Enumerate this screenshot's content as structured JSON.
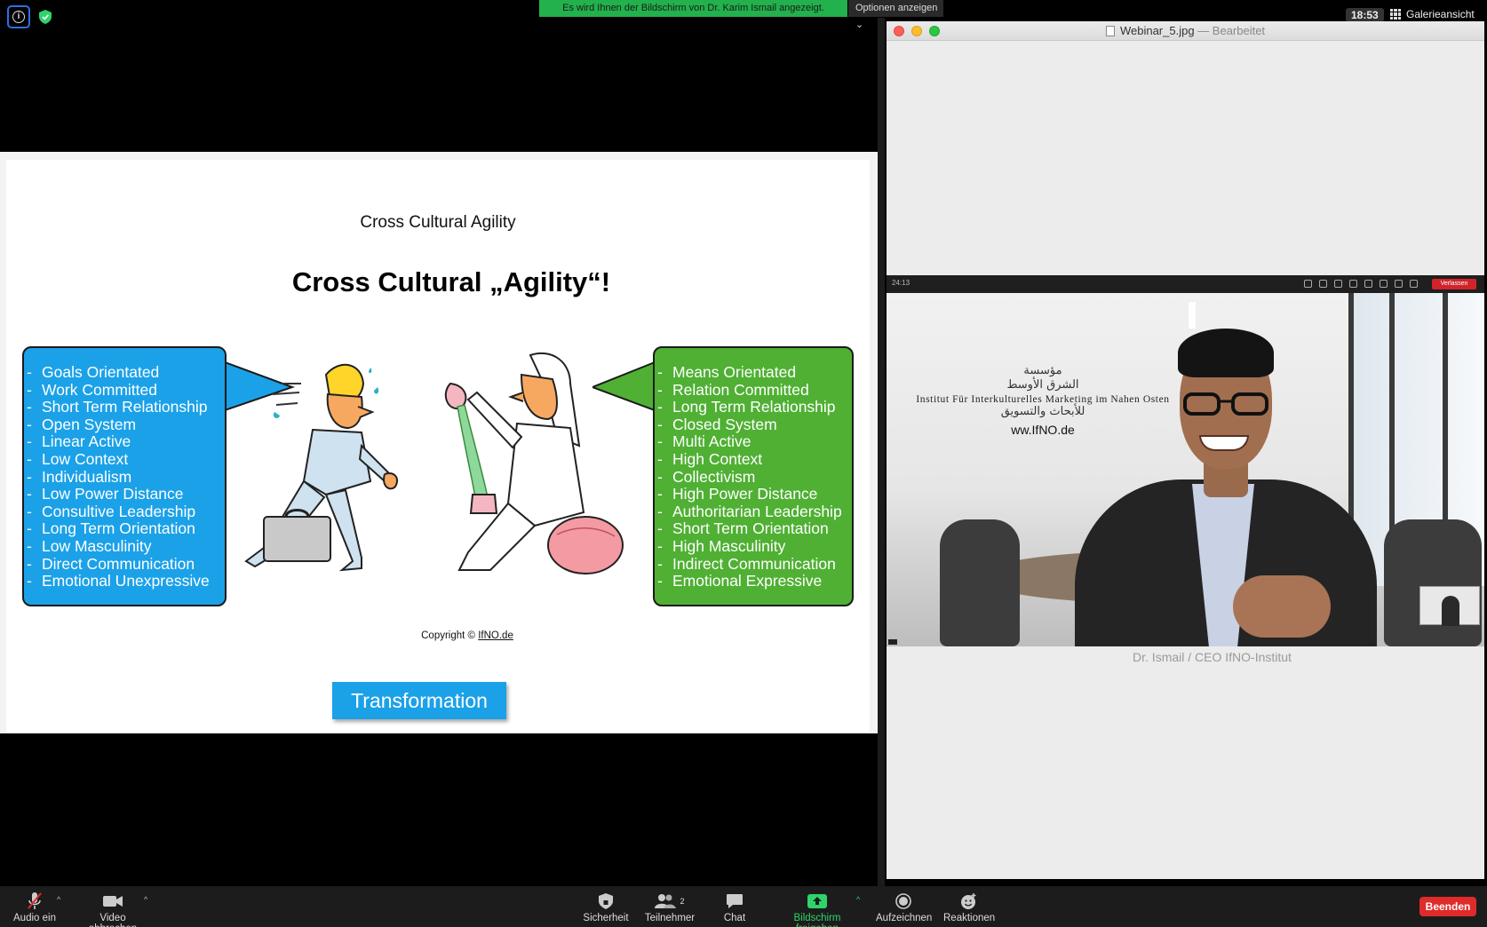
{
  "zoom": {
    "share_banner": "Es wird Ihnen der Bildschirm von Dr. Karim Ismail angezeigt.",
    "options_label": "Optionen anzeigen",
    "clock": "18:53",
    "gallery_label": "Galerieansicht",
    "accent_green": "#22b14c",
    "end_color": "#e02b2b"
  },
  "slide": {
    "heading": "Cross Cultural Agility",
    "title": "Cross Cultural „Agility“!",
    "left_items": [
      "Goals Orientated",
      "Work Committed",
      "Short Term Relationship",
      "Open System",
      "Linear Active",
      "Low Context",
      "Individualism",
      "Low Power Distance",
      "Consultive Leadership",
      "Long Term Orientation",
      "Low Masculinity",
      "Direct Communication",
      "Emotional Unexpressive"
    ],
    "right_items": [
      "Means Orientated",
      "Relation Committed",
      "Long Term Relationship",
      "Closed System",
      "Multi Active",
      "High Context",
      "Collectivism",
      "High Power Distance",
      "Authoritarian Leadership",
      "Short Term Orientation",
      "High Masculinity",
      "Indirect Communication",
      "Emotional Expressive"
    ],
    "copyright_prefix": "Copyright ©",
    "copyright_link": "IfNO.de",
    "button": "Transformation",
    "blue": "#1ba1e8",
    "green": "#4fb033"
  },
  "preview": {
    "file_name": "Webinar_5.jpg",
    "edited": "— Bearbeitet",
    "zoom_time": "24:13",
    "leave": "Verlassen",
    "institute_arabic_1": "مؤسسة",
    "institute_arabic_2": "الشرق الأوسط",
    "institute_name": "Institut Für Interkulturelles Marketing im Nahen Osten",
    "institute_arabic_3": "للأبحاث والتسويق",
    "website": "ww.IfNO.de",
    "caption": "Dr. Ismail / CEO IfNO-Institut"
  },
  "toolbar": {
    "audio": "Audio ein",
    "video": "Video abbrechen",
    "security": "Sicherheit",
    "participants": "Teilnehmer",
    "participants_count": "2",
    "chat": "Chat",
    "share": "Bildschirm freigeben",
    "record": "Aufzeichnen",
    "reactions": "Reaktionen",
    "end": "Beenden"
  }
}
